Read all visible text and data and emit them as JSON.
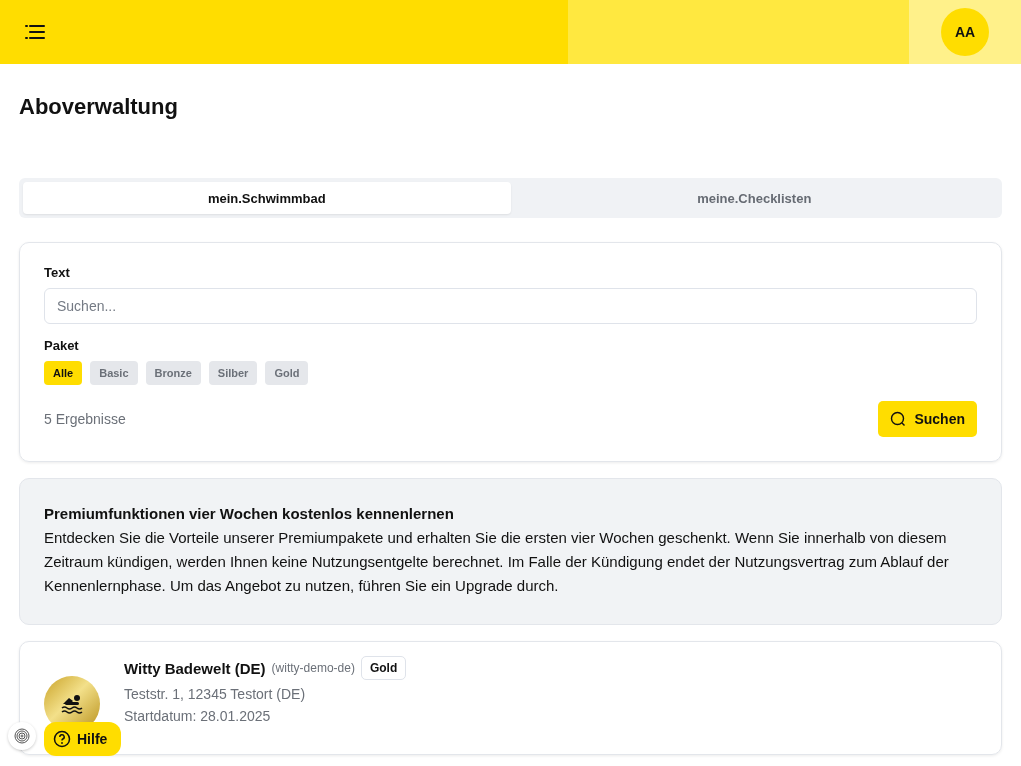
{
  "header": {
    "avatar": "AA"
  },
  "page": {
    "title": "Aboverwaltung"
  },
  "tabs": [
    {
      "label": "mein.Schwimmbad",
      "selected": true
    },
    {
      "label": "meine.Checklisten",
      "selected": false
    }
  ],
  "filter": {
    "text_label": "Text",
    "placeholder": "Suchen...",
    "package_label": "Paket",
    "packages": [
      {
        "label": "Alle",
        "selected": true
      },
      {
        "label": "Basic",
        "selected": false
      },
      {
        "label": "Bronze",
        "selected": false
      },
      {
        "label": "Silber",
        "selected": false
      },
      {
        "label": "Gold",
        "selected": false
      }
    ],
    "results": "5 Ergebnisse",
    "search_button": "Suchen"
  },
  "promo": {
    "title": "Premiumfunktionen vier Wochen kostenlos kennenlernen",
    "text": "Entdecken Sie die Vorteile unserer Premiumpakete und erhalten Sie die ersten vier Wochen geschenkt. Wenn Sie innerhalb von diesem Zeitraum kündigen, werden Ihnen keine Nutzungsentgelte berechnet. Im Falle der Kündigung endet der Nutzungsvertrag zum Ablauf der Kennenlernphase. Um das Angebot zu nutzen, führen Sie ein Upgrade durch."
  },
  "pools": [
    {
      "name": "Witty Badewelt (DE)",
      "slug": "(witty-demo-de)",
      "package": "Gold",
      "address": "Teststr. 1, 12345 Testort (DE)",
      "start": "Startdatum: 28.01.2025"
    }
  ],
  "help_button": "Hilfe"
}
